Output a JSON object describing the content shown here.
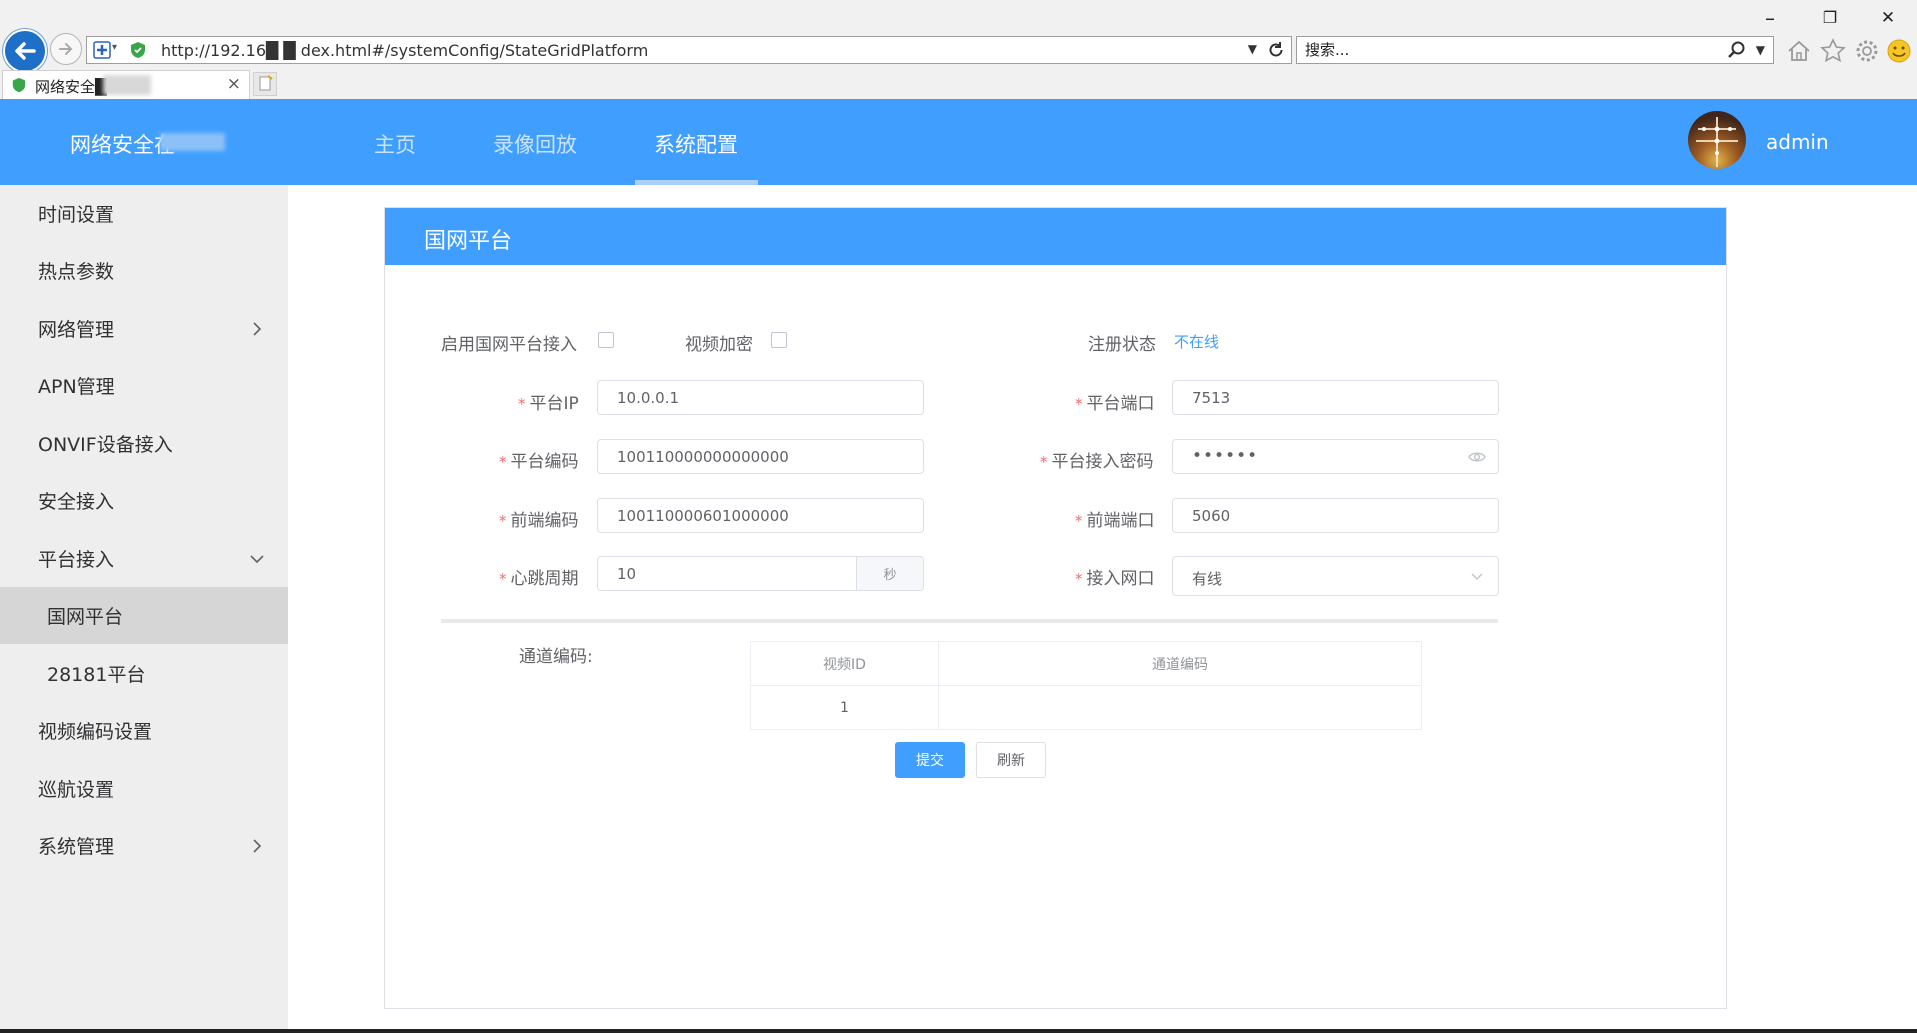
{
  "browser": {
    "address_url": "http://192.16█ █ dex.html#/systemConfig/StateGridPlatform",
    "search_placeholder": "搜索...",
    "tab_title": "网络安全█",
    "tab_close": "×",
    "win_minimize": "–",
    "win_restore": "❐",
    "win_close": "✕"
  },
  "header": {
    "app_title": "网络安全在",
    "nav": [
      {
        "label": "主页"
      },
      {
        "label": "录像回放"
      },
      {
        "label": "系统配置"
      }
    ],
    "user": "admin"
  },
  "sidebar": {
    "items": [
      {
        "label": "时间设置"
      },
      {
        "label": "热点参数"
      },
      {
        "label": "网络管理",
        "icon": "chevron-right-icon"
      },
      {
        "label": "APN管理"
      },
      {
        "label": "ONVIF设备接入"
      },
      {
        "label": "安全接入"
      },
      {
        "label": "平台接入",
        "icon": "chevron-down-icon"
      },
      {
        "label": "国网平台"
      },
      {
        "label": "28181平台"
      },
      {
        "label": "视频编码设置"
      },
      {
        "label": "巡航设置"
      },
      {
        "label": "系统管理",
        "icon": "chevron-right-icon"
      }
    ]
  },
  "panel": {
    "title": "国网平台",
    "form": {
      "enable_label": "启用国网平台接入",
      "encrypt_label": "视频加密",
      "reg_status_label": "注册状态",
      "reg_status_value": "不在线",
      "platform_ip_label": "平台IP",
      "platform_ip_value": "10.0.0.1",
      "platform_port_label": "平台端口",
      "platform_port_value": "7513",
      "platform_code_label": "平台编码",
      "platform_code_value": "100110000000000000",
      "platform_pwd_label": "平台接入密码",
      "platform_pwd_value": "••••••",
      "front_code_label": "前端编码",
      "front_code_value": "100110000601000000",
      "front_port_label": "前端端口",
      "front_port_value": "5060",
      "heartbeat_label": "心跳周期",
      "heartbeat_value": "10",
      "heartbeat_unit": "秒",
      "netport_label": "接入网口",
      "netport_value": "有线",
      "required_mark": "*"
    },
    "channel": {
      "label": "通道编码:",
      "columns": [
        "视频ID",
        "通道编码"
      ],
      "rows": [
        [
          "1",
          ""
        ]
      ]
    },
    "buttons": {
      "submit": "提交",
      "refresh": "刷新"
    }
  },
  "colors": {
    "primary": "#409eff",
    "sidebar_bg": "#eeeeee",
    "required": "#f56c6c"
  }
}
